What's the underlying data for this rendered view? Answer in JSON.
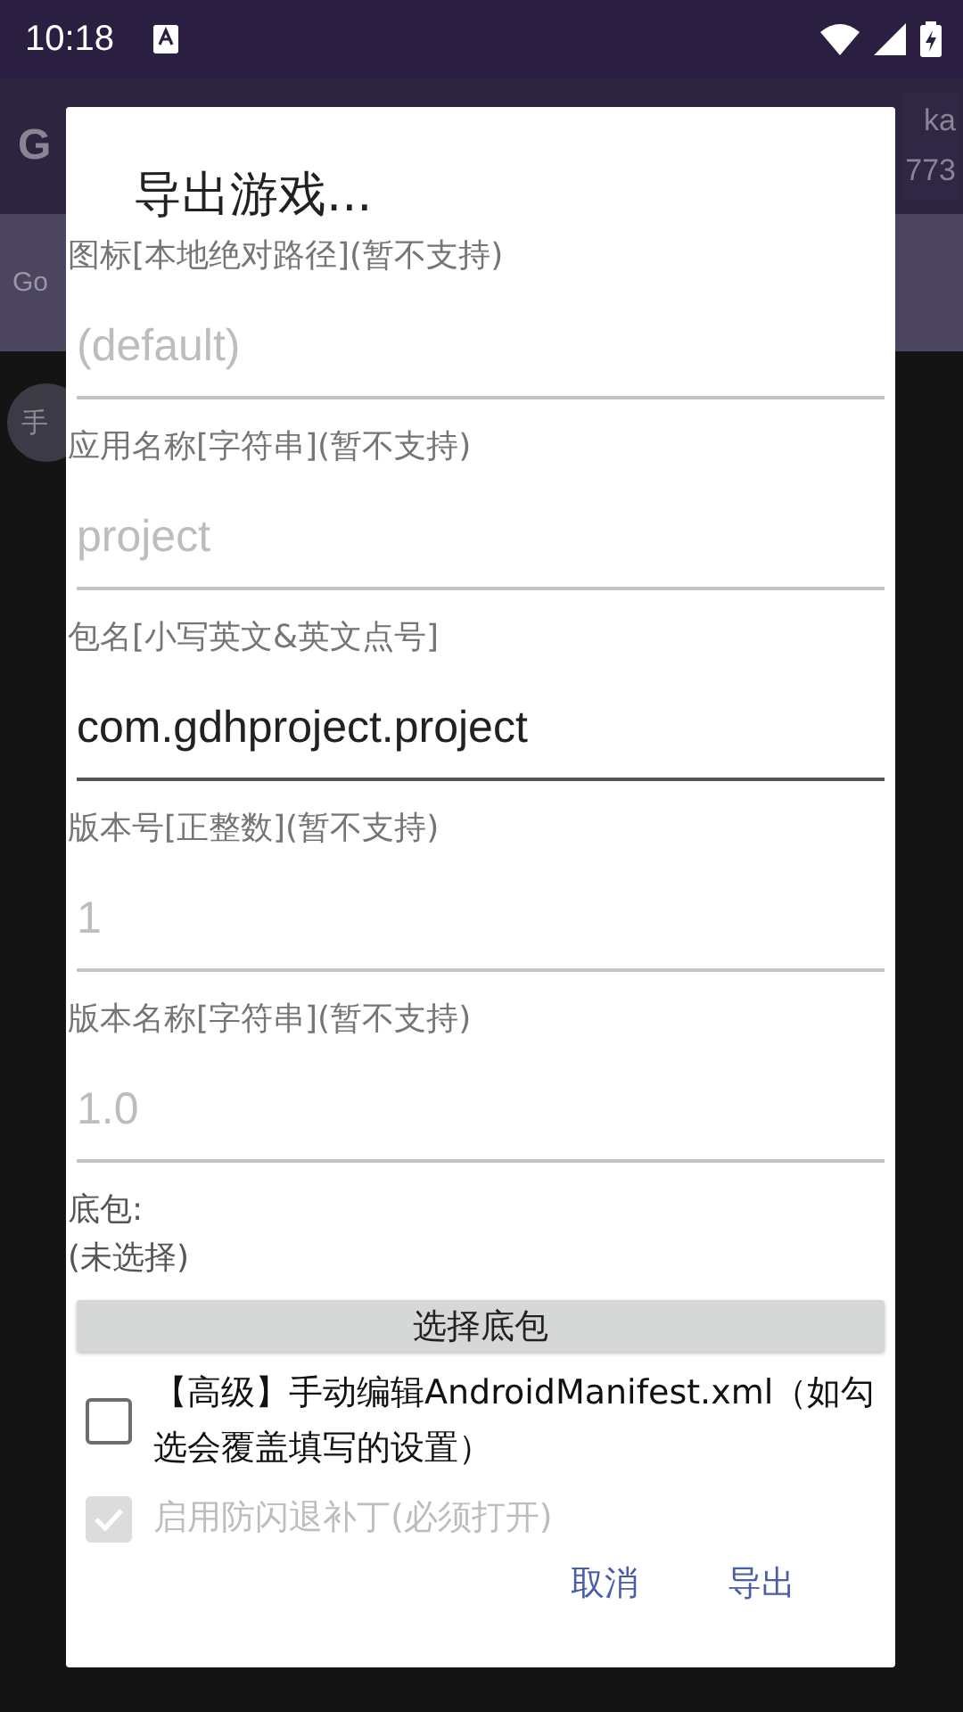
{
  "status_bar": {
    "time": "10:18"
  },
  "background": {
    "app_title": "G",
    "badge_lines": [
      "ka",
      "773"
    ],
    "tab": "Go",
    "chip": "手"
  },
  "dialog": {
    "title": "导出游戏...",
    "fields": [
      {
        "label": "图标[本地绝对路径](暂不支持)",
        "placeholder": "(default)",
        "disabled": true
      },
      {
        "label": "应用名称[字符串](暂不支持)",
        "placeholder": "project",
        "disabled": true
      },
      {
        "label": "包名[小写英文&英文点号]",
        "value": "com.gdhproject.project",
        "disabled": false
      },
      {
        "label": "版本号[正整数](暂不支持)",
        "value": "1",
        "disabled": true
      },
      {
        "label": "版本名称[字符串](暂不支持)",
        "value": "1.0",
        "disabled": true
      }
    ],
    "base_package": {
      "label": "底包:",
      "status": "(未选择)",
      "button": "选择底包"
    },
    "checkboxes": [
      {
        "label": "【高级】手动编辑AndroidManifest.xml（如勾选会覆盖填写的设置）",
        "checked": false,
        "disabled": false
      },
      {
        "label": "启用防闪退补丁(必须打开)",
        "checked": true,
        "disabled": true
      }
    ],
    "buttons": [
      "取消",
      "导出"
    ]
  }
}
